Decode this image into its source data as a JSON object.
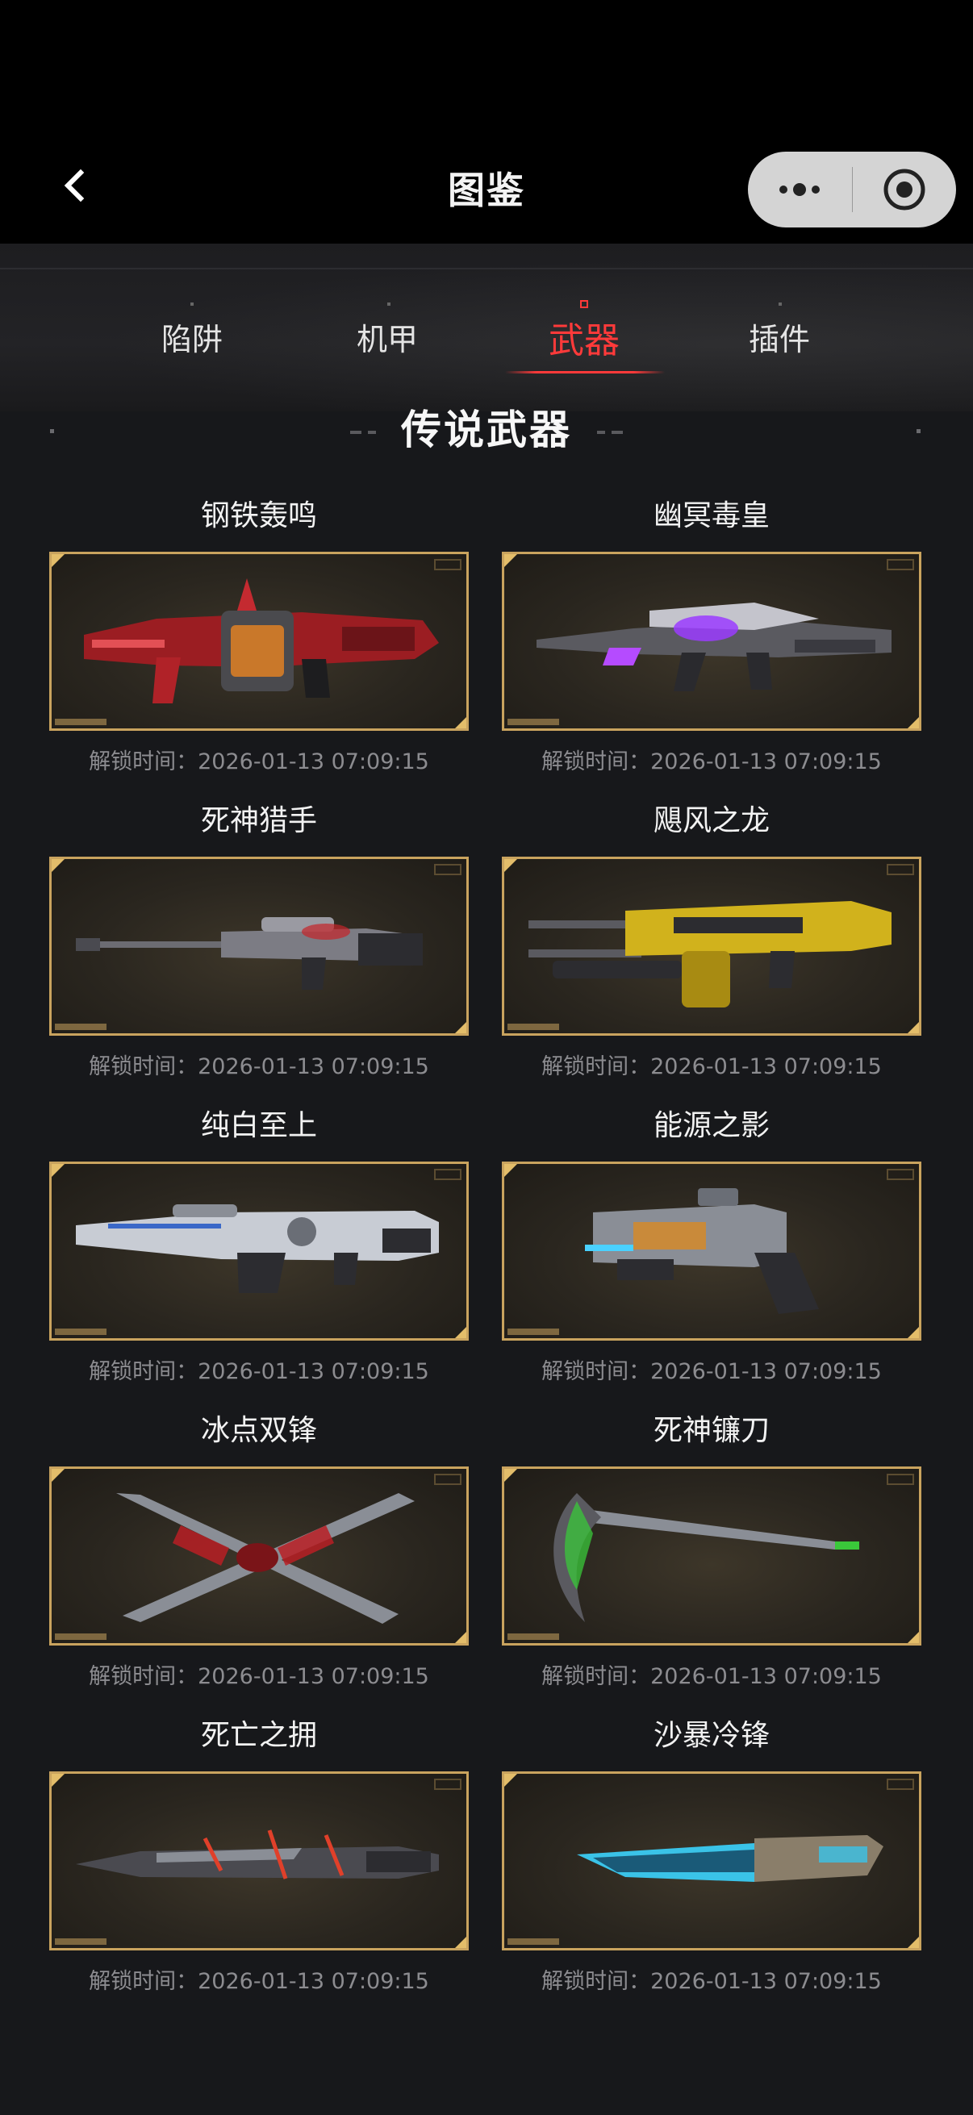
{
  "header": {
    "title": "图鉴",
    "back_icon": "chevron-left-icon",
    "more_icon": "more-dots-icon",
    "close_icon": "target-circle-icon"
  },
  "tabs": [
    {
      "label": "陷阱",
      "active": false
    },
    {
      "label": "机甲",
      "active": false
    },
    {
      "label": "武器",
      "active": true
    },
    {
      "label": "插件",
      "active": false
    }
  ],
  "section": {
    "title": "传说武器"
  },
  "colors": {
    "accent": "#ff3a3a",
    "frame_gold": "#c9a35e",
    "background": "#17181b"
  },
  "weapons": [
    {
      "name": "钢铁轰鸣",
      "unlock": "解锁时间：2026-01-13 07:09:15",
      "art": "red-heavy-gun"
    },
    {
      "name": "幽冥毒皇",
      "unlock": "解锁时间：2026-01-13 07:09:15",
      "art": "purple-rifle"
    },
    {
      "name": "死神猎手",
      "unlock": "解锁时间：2026-01-13 07:09:15",
      "art": "sniper-rifle"
    },
    {
      "name": "飓风之龙",
      "unlock": "解锁时间：2026-01-13 07:09:15",
      "art": "gold-machine-gun"
    },
    {
      "name": "纯白至上",
      "unlock": "解锁时间：2026-01-13 07:09:15",
      "art": "white-rifle"
    },
    {
      "name": "能源之影",
      "unlock": "解锁时间：2026-01-13 07:09:15",
      "art": "energy-pistol"
    },
    {
      "name": "冰点双锋",
      "unlock": "解锁时间：2026-01-13 07:09:15",
      "art": "crossed-blades"
    },
    {
      "name": "死神镰刀",
      "unlock": "解锁时间：2026-01-13 07:09:15",
      "art": "scythe"
    },
    {
      "name": "死亡之拥",
      "unlock": "解锁时间：2026-01-13 07:09:15",
      "art": "red-sword"
    },
    {
      "name": "沙暴冷锋",
      "unlock": "解锁时间：2026-01-13 07:09:15",
      "art": "ice-blade"
    }
  ]
}
